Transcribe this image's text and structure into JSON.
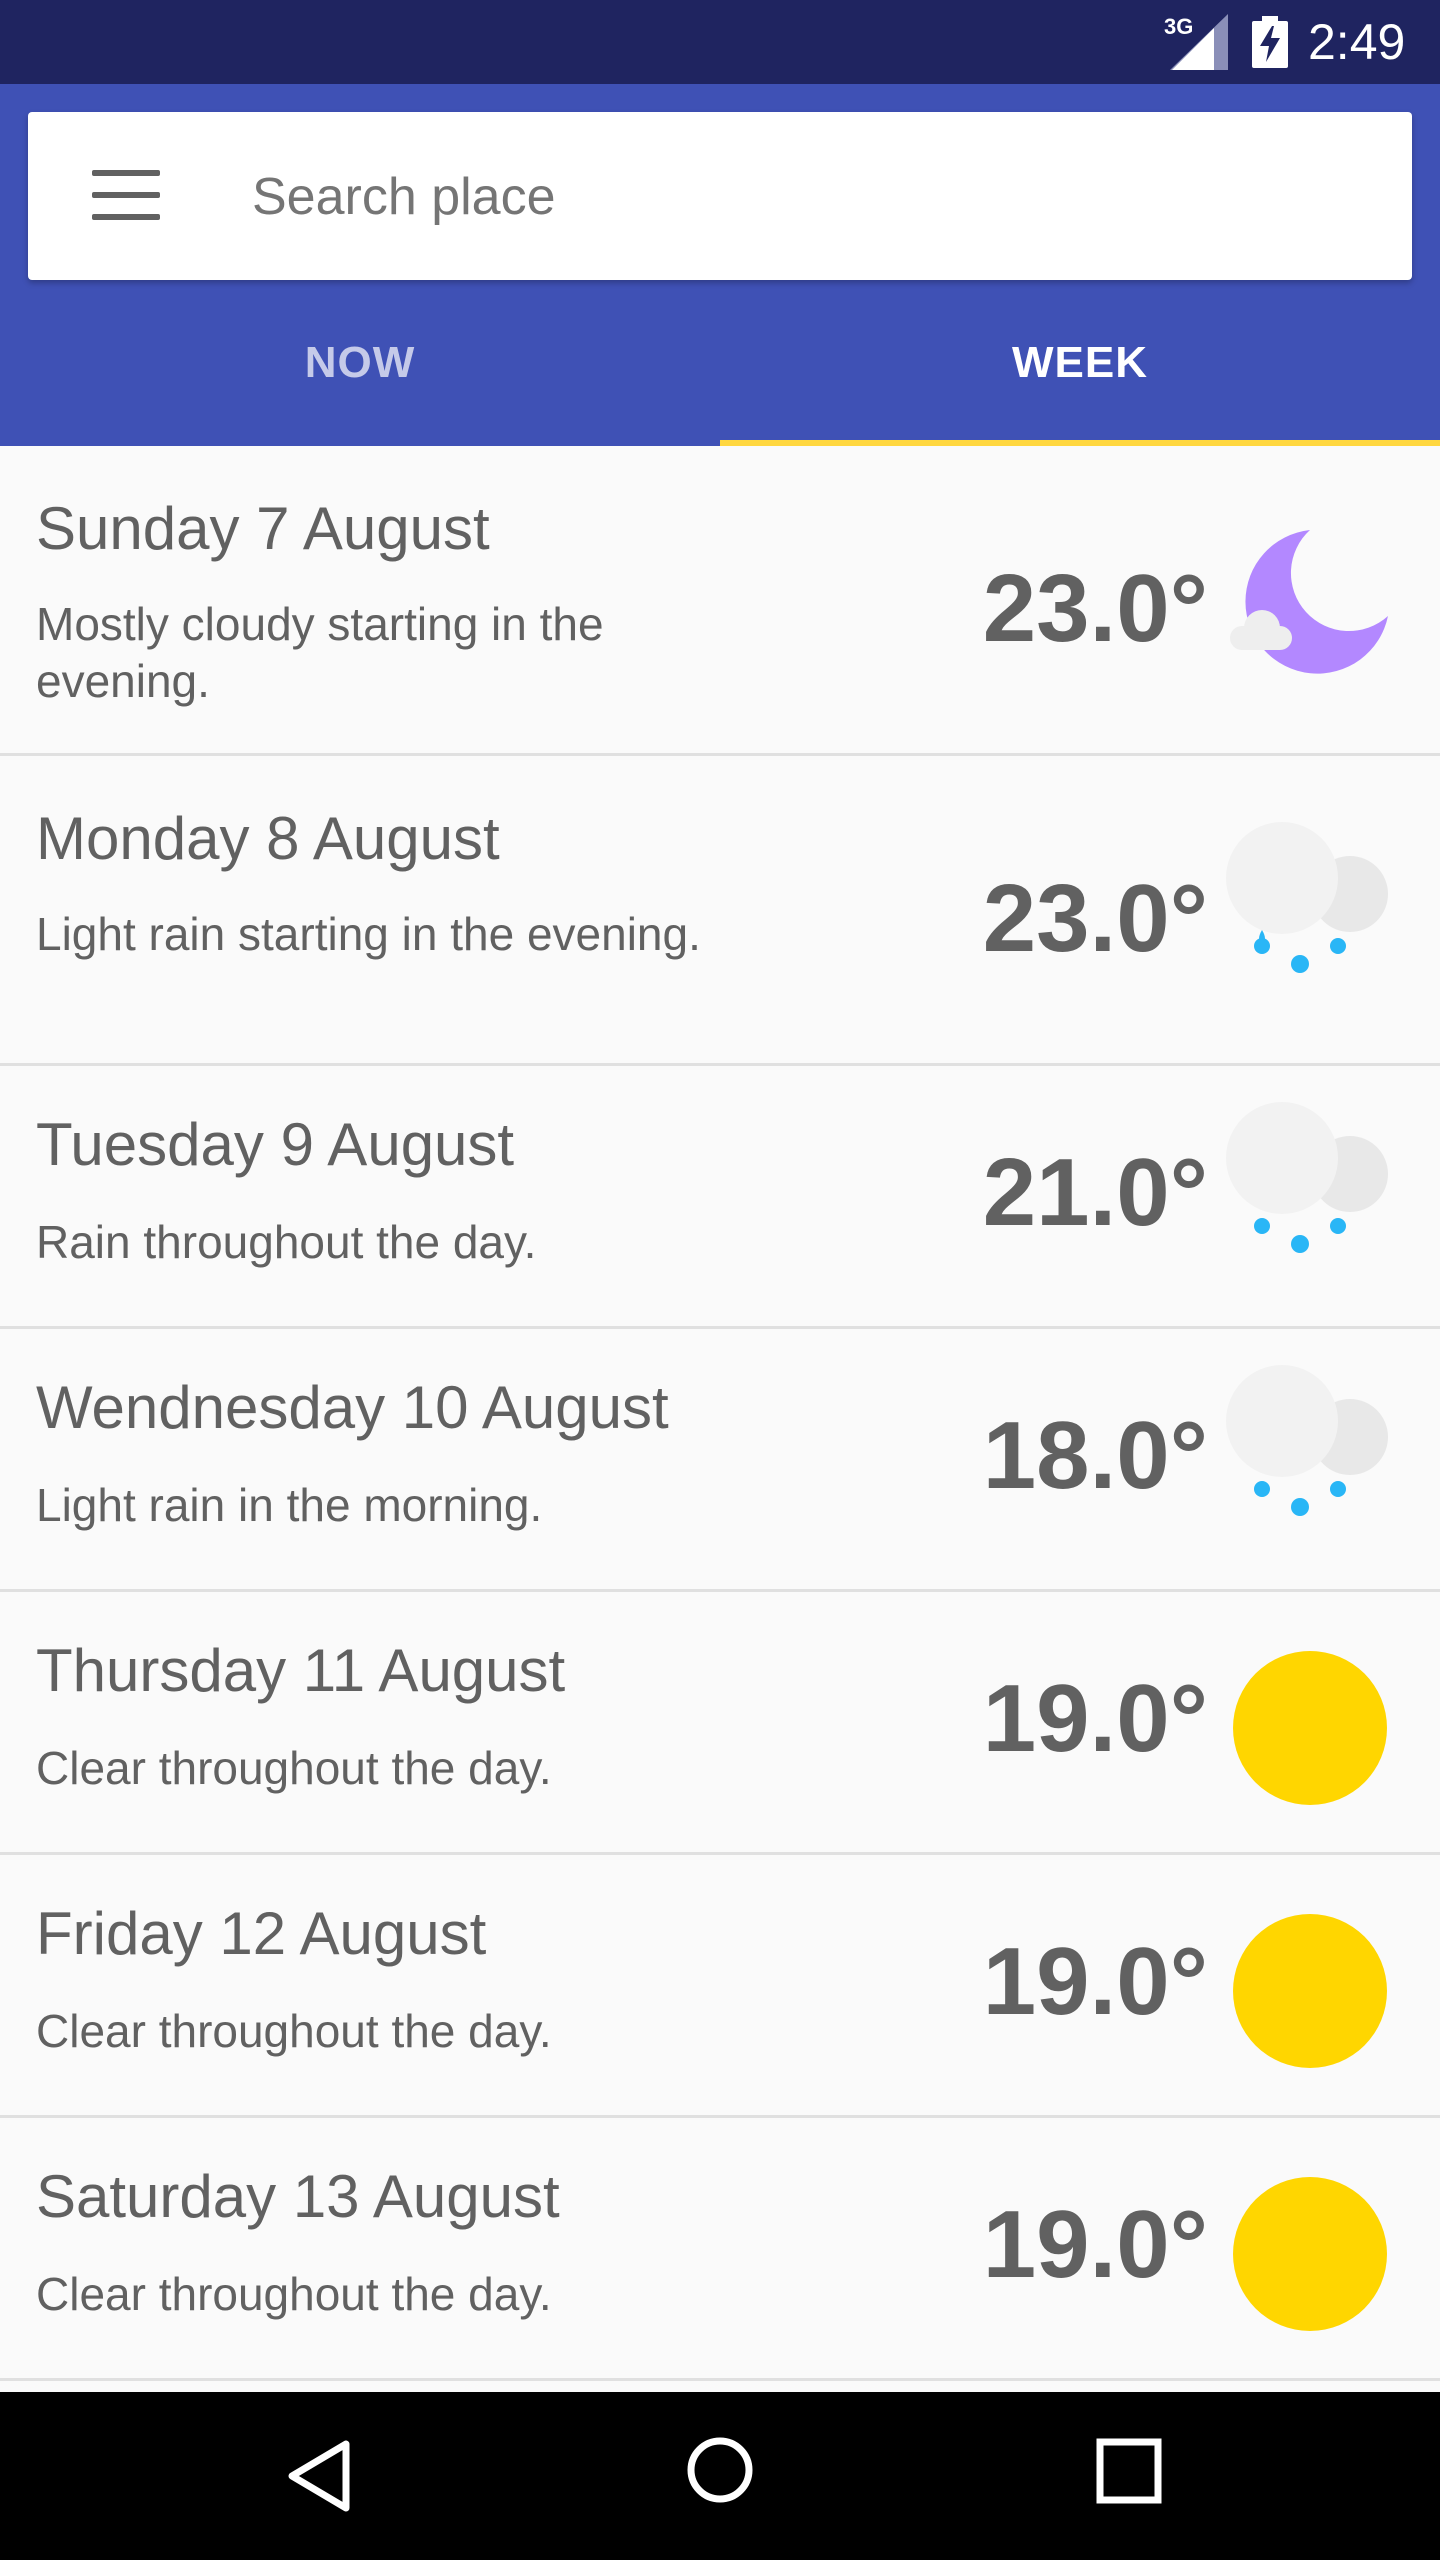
{
  "status_bar": {
    "network": "3G",
    "time": "2:49"
  },
  "search": {
    "placeholder": "Search place"
  },
  "tabs": [
    {
      "label": "NOW",
      "selected": false
    },
    {
      "label": "WEEK",
      "selected": true
    }
  ],
  "colors": {
    "status_bar": "#1f2460",
    "primary": "#3f51b5",
    "tab_indicator": "#ffd740",
    "moon": "#b388ff",
    "sun": "#ffd600",
    "rain_drop": "#29b6f6"
  },
  "forecast": [
    {
      "day": "Sunday 7 August",
      "summary": "Mostly cloudy starting in the evening.",
      "temp": "23.0°",
      "icon": "moon-cloud-icon"
    },
    {
      "day": "Monday 8 August",
      "summary": "Light rain starting in the evening.",
      "temp": "23.0°",
      "icon": "rain-cloud-icon"
    },
    {
      "day": "Tuesday 9 August",
      "summary": "Rain throughout the day.",
      "temp": "21.0°",
      "icon": "rain-cloud-icon"
    },
    {
      "day": "Wendnesday 10 August",
      "summary": "Light rain in the morning.",
      "temp": "18.0°",
      "icon": "rain-cloud-icon"
    },
    {
      "day": "Thursday 11 August",
      "summary": "Clear throughout the day.",
      "temp": "19.0°",
      "icon": "sun-icon"
    },
    {
      "day": "Friday 12 August",
      "summary": "Clear throughout the day.",
      "temp": "19.0°",
      "icon": "sun-icon"
    },
    {
      "day": "Saturday 13 August",
      "summary": "Clear throughout the day.",
      "temp": "19.0°",
      "icon": "sun-icon"
    }
  ],
  "nav_bar": {
    "buttons": [
      "back-icon",
      "home-icon",
      "recent-apps-icon"
    ]
  }
}
